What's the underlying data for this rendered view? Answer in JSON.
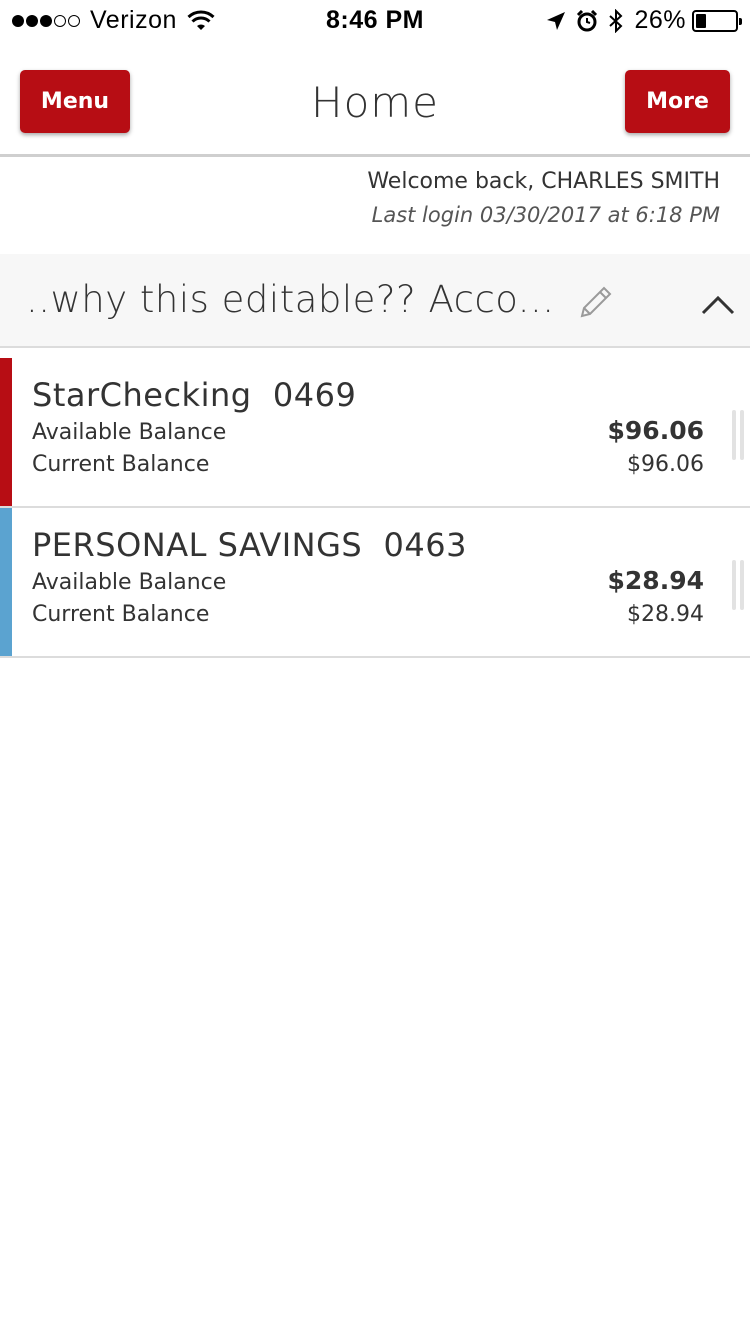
{
  "status_bar": {
    "carrier": "Verizon",
    "signal_bars_filled": 3,
    "signal_bars_total": 5,
    "time": "8:46 PM",
    "battery_percent": "26%",
    "battery_level": 0.26,
    "icons": [
      "wifi-icon",
      "location-arrow-icon",
      "alarm-icon",
      "bluetooth-icon",
      "battery-icon"
    ]
  },
  "header": {
    "menu_label": "Menu",
    "title": "Home",
    "more_label": "More",
    "button_color": "#b70d14"
  },
  "welcome": {
    "greeting": "Welcome back, CHARLES SMITH",
    "last_login": "Last login 03/30/2017 at 6:18 PM"
  },
  "account_group": {
    "title": "..why this editable?? Acco...",
    "icons": [
      "pencil-icon",
      "chevron-up-icon"
    ]
  },
  "accounts": [
    {
      "name": "StarChecking  0469",
      "available_label": "Available Balance",
      "available_amount": "$96.06",
      "current_label": "Current Balance",
      "current_amount": "$96.06",
      "color": "#b70d14"
    },
    {
      "name": "PERSONAL SAVINGS  0463",
      "available_label": "Available Balance",
      "available_amount": "$28.94",
      "current_label": "Current Balance",
      "current_amount": "$28.94",
      "color": "#5ba3d0"
    }
  ]
}
